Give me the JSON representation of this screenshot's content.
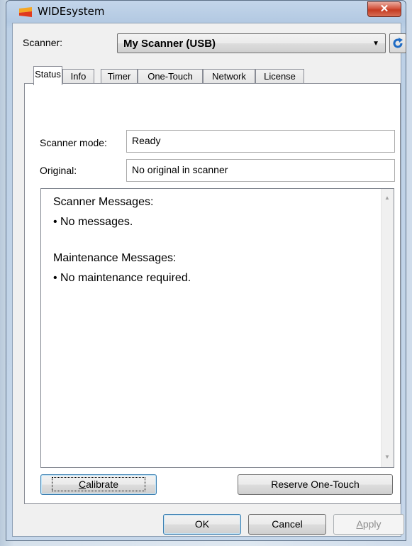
{
  "window": {
    "title": "WIDEsystem",
    "close_glyph": "✕"
  },
  "scanner": {
    "label": "Scanner:",
    "selected": "My Scanner (USB)"
  },
  "tabs": [
    {
      "label": "Status"
    },
    {
      "label": "Info"
    },
    {
      "label": "Timer"
    },
    {
      "label": "One-Touch"
    },
    {
      "label": "Network"
    },
    {
      "label": "License"
    }
  ],
  "status": {
    "mode_label": "Scanner mode:",
    "mode_value": "Ready",
    "original_label": "Original:",
    "original_value": "No original in scanner"
  },
  "messages": {
    "scanner_heading": "Scanner Messages:",
    "scanner_item": "• No messages.",
    "maintenance_heading": "Maintenance Messages:",
    "maintenance_item": "• No maintenance required."
  },
  "buttons": {
    "calibrate_first": "C",
    "calibrate_rest": "alibrate",
    "reserve": "Reserve One-Touch",
    "ok": "OK",
    "cancel": "Cancel",
    "apply_first": "A",
    "apply_rest": "pply"
  },
  "icons": [
    "app-logo-icon",
    "close-icon",
    "dropdown-arrow-icon",
    "refresh-icon",
    "scroll-up-icon",
    "scroll-down-icon"
  ],
  "colors": {
    "close_red": "#c43b22",
    "refresh_blue": "#1e6bc4",
    "focus_blue": "#3c7fb1"
  }
}
